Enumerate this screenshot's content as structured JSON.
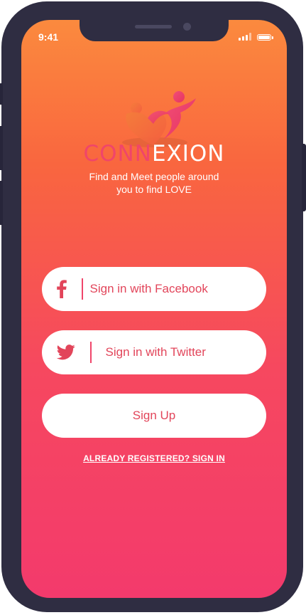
{
  "status_bar": {
    "time": "9:41"
  },
  "brand": {
    "part1": "CONN",
    "part2": "EXION",
    "tagline_line1": "Find and Meet people around",
    "tagline_line2": "you to find LOVE"
  },
  "buttons": {
    "facebook_label": "Sign in with Facebook",
    "twitter_label": "Sign in with Twitter",
    "signup_label": "Sign Up"
  },
  "links": {
    "signin": "ALREADY REGISTERED? SIGN IN"
  },
  "icons": [
    "logo-icon",
    "facebook-icon",
    "twitter-icon",
    "signal-icon",
    "battery-icon"
  ],
  "colors": {
    "gradient_top": "#fb8a3e",
    "gradient_bottom": "#f33a6c",
    "accent": "#f0456a",
    "frame": "#2f2d42",
    "button_text": "#e2455a"
  }
}
